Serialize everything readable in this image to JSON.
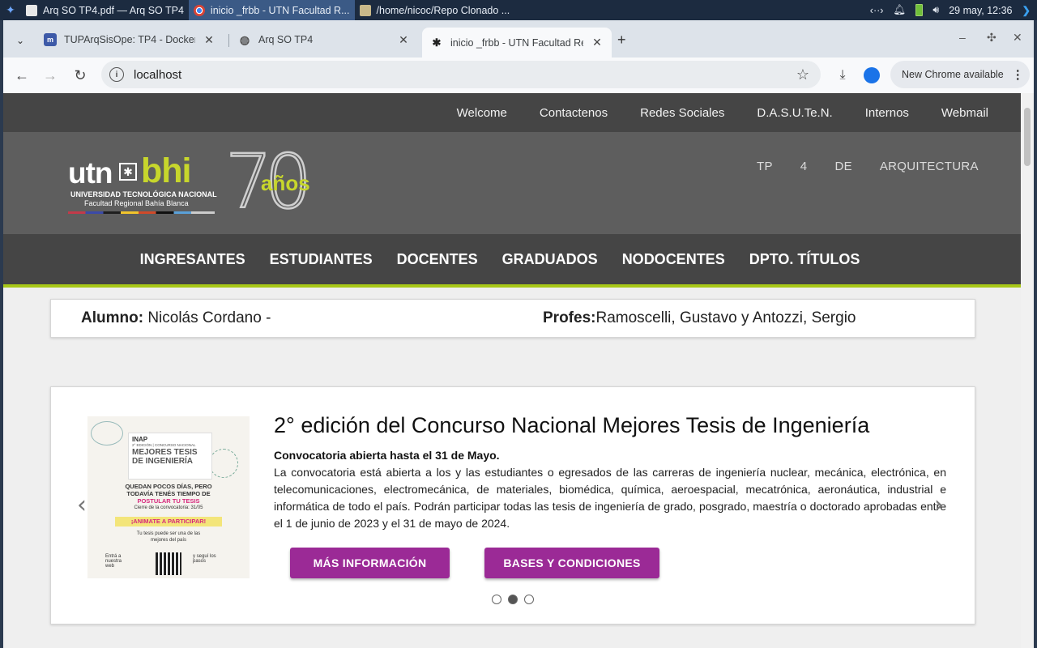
{
  "taskbar": {
    "tasks": [
      {
        "label": "Arq SO TP4.pdf — Arq SO TP4"
      },
      {
        "label": "inicio _frbb - UTN Facultad R..."
      },
      {
        "label": "/home/nicoc/Repo Clonado ..."
      }
    ],
    "network_label": "‹··›",
    "clock": "29 may, 12:36"
  },
  "browser": {
    "tabs": [
      {
        "title": "TUPArqSisOpe: TP4 - Docker -"
      },
      {
        "title": "Arq SO TP4"
      },
      {
        "title": "inicio _frbb - UTN Facultad Re"
      }
    ],
    "new_tab": "+",
    "url": "localhost",
    "update_label": "New Chrome available"
  },
  "site": {
    "top_nav": [
      "Welcome",
      "Contactenos",
      "Redes Sociales",
      "D.A.S.U.Te.N.",
      "Internos",
      "Webmail"
    ],
    "logo": {
      "utn": "utn",
      "bhi": "bhi",
      "line1": "UNIVERSIDAD TECNOLÓGICA NACIONAL",
      "line2": "Facultad Regional Bahía Blanca",
      "seventy": "70",
      "anos": "años"
    },
    "header_words": [
      "TP",
      "4",
      "DE",
      "ARQUITECTURA"
    ],
    "main_nav": [
      "INGRESANTES",
      "ESTUDIANTES",
      "DOCENTES",
      "GRADUADOS",
      "NODOCENTES",
      "DPTO. TÍTULOS"
    ],
    "info": {
      "alumno_label": "Alumno:",
      "alumno_value": " Nicolás Cordano -",
      "profes_label": "Profes:",
      "profes_value": "Ramoscelli, Gustavo y Antozzi, Sergio"
    },
    "news": {
      "title": "2° edición del Concurso Nacional Mejores Tesis de Ingeniería",
      "subtitle": "Convocatoria abierta hasta el 31 de Mayo.",
      "body": "La convocatoria está abierta a los y las estudiantes o egresados de las carreras de ingeniería nuclear, mecánica, electrónica, en telecomunicaciones, electromecánica, de materiales, biomédica, química, aeroespacial, mecatrónica, aeronáutica, industrial e informática de todo el país. Podrán participar todas las tesis de ingeniería de grado, posgrado, maestría o doctorado aprobadas entre el 1 de junio de 2023 y el 31 de mayo de 2024.",
      "btn_more": "MÁS INFORMACIÓN",
      "btn_bases": "BASES Y CONDICIONES",
      "prev": "‹",
      "next": "›",
      "slides_total": 3,
      "slide_active": 2
    },
    "poster": {
      "org": "INAP",
      "edition": "2° EDICIÓN | CONCURSO NACIONAL",
      "headline1": "MEJORES TESIS",
      "headline2": "DE INGENIERÍA",
      "line1": "QUEDAN POCOS DÍAS, PERO",
      "line2": "TODAVÍA TENÉS TIEMPO DE",
      "line3": "POSTULAR TU TESIS",
      "close": "Cierre de la convocatoria: 31/05",
      "cta": "¡ANIMATE A PARTICIPAR!",
      "small1": "Tu tesis puede ser una de las",
      "small2": "mejores del país",
      "foot_left": "Entrá a nuestra web",
      "foot_right": "y seguí los pasos"
    }
  },
  "colors": {
    "accent_green": "#a8c818",
    "button_purple": "#9b2a96",
    "nav_dark": "#454545",
    "header_gray": "#5e5e5e"
  }
}
